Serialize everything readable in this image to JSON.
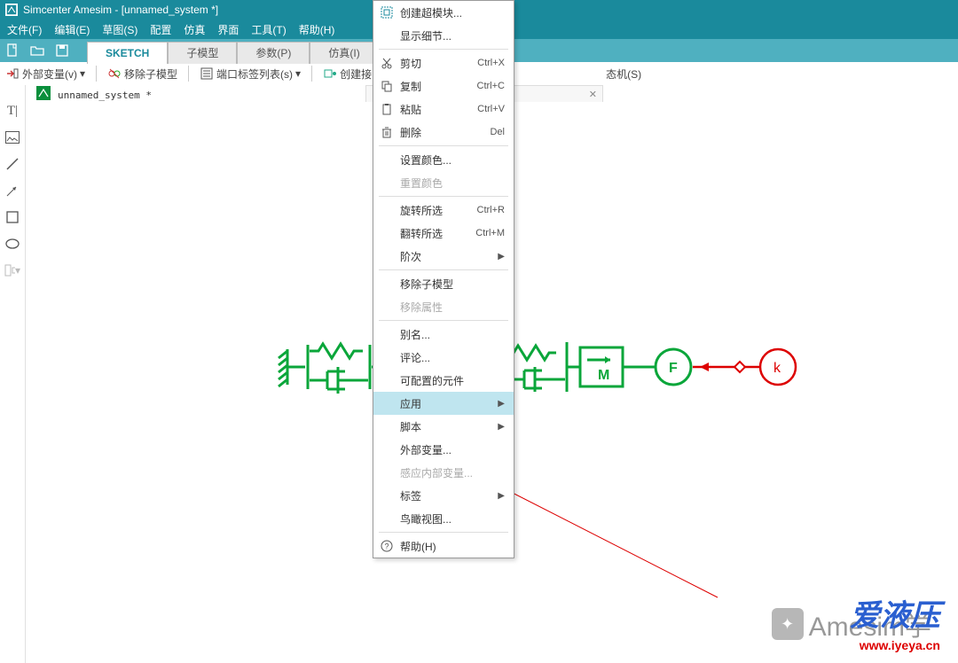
{
  "title": "Simcenter Amesim - [unnamed_system *]",
  "menubar": [
    "文件(F)",
    "编辑(E)",
    "草图(S)",
    "配置",
    "仿真",
    "界面",
    "工具(T)",
    "帮助(H)"
  ],
  "tabs": {
    "items": [
      {
        "label": "SKETCH",
        "active": true
      },
      {
        "label": "子模型",
        "active": false
      },
      {
        "label": "参数(P)",
        "active": false
      },
      {
        "label": "仿真(I)",
        "active": false
      }
    ]
  },
  "toolbar2": {
    "ext_var": "外部变量(v)",
    "rm_sub": "移除子模型",
    "port_list": "端口标签列表(s)",
    "create_icon": "创建接口图标(v)",
    "state": "态机(S)"
  },
  "doc": {
    "label": "unnamed_system *"
  },
  "ctx": [
    {
      "type": "item",
      "icon": "supercomponent",
      "label": "创建超模块..."
    },
    {
      "type": "item",
      "label": "显示细节..."
    },
    {
      "type": "sep"
    },
    {
      "type": "item",
      "icon": "cut",
      "label": "剪切",
      "sc": "Ctrl+X"
    },
    {
      "type": "item",
      "icon": "copy",
      "label": "复制",
      "sc": "Ctrl+C"
    },
    {
      "type": "item",
      "icon": "paste",
      "label": "粘贴",
      "sc": "Ctrl+V"
    },
    {
      "type": "item",
      "icon": "delete",
      "label": "删除",
      "sc": "Del"
    },
    {
      "type": "sep"
    },
    {
      "type": "item",
      "label": "设置颜色..."
    },
    {
      "type": "item",
      "label": "重置颜色",
      "disabled": true
    },
    {
      "type": "sep"
    },
    {
      "type": "item",
      "label": "旋转所选",
      "sc": "Ctrl+R"
    },
    {
      "type": "item",
      "label": "翻转所选",
      "sc": "Ctrl+M"
    },
    {
      "type": "item",
      "label": "阶次",
      "sub": true
    },
    {
      "type": "sep"
    },
    {
      "type": "item",
      "label": "移除子模型"
    },
    {
      "type": "item",
      "label": "移除属性",
      "disabled": true
    },
    {
      "type": "sep"
    },
    {
      "type": "item",
      "label": "别名..."
    },
    {
      "type": "item",
      "label": "评论..."
    },
    {
      "type": "item",
      "label": "可配置的元件"
    },
    {
      "type": "item",
      "label": "应用",
      "hi": true,
      "sub": true
    },
    {
      "type": "item",
      "label": "脚本",
      "sub": true
    },
    {
      "type": "item",
      "label": "外部变量..."
    },
    {
      "type": "item",
      "label": "感应内部变量...",
      "disabled": true
    },
    {
      "type": "item",
      "label": "标签",
      "sub": true
    },
    {
      "type": "item",
      "label": "鸟瞰视图..."
    },
    {
      "type": "sep"
    },
    {
      "type": "item",
      "icon": "help",
      "label": "帮助(H)"
    }
  ],
  "diagram": {
    "f_label": "F",
    "m_label": "M",
    "k_label": "k",
    "arrow": "→"
  },
  "watermark": {
    "brand_cn": "Amesim学",
    "brand2": "爱液压",
    "url": "www.iyeya.cn"
  }
}
